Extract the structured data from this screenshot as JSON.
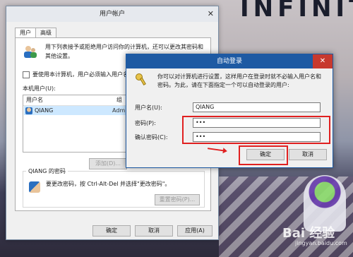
{
  "main_dialog": {
    "title": "用户帐户",
    "tabs": [
      "用户",
      "高级"
    ],
    "intro": "用下列表接予或拒绝用户访问你的计算机，还可以更改其密码和其他设置。",
    "checkbox_label": "要使用本计算机，用户必须输入用户名和密",
    "users_label": "本机用户(U):",
    "columns": [
      "用户名",
      "组"
    ],
    "rows": [
      {
        "name": "QIANG",
        "group": "Admi"
      }
    ],
    "buttons": {
      "add": "添加(D)...",
      "reset_password": "重置密码(P)...",
      "ok": "确定",
      "cancel": "取消",
      "apply": "应用(A)"
    },
    "password_group_title": "QIANG 的密码",
    "password_text": "要更改密码，按 Ctrl-Alt-Del 并选择\"更改密码\"。"
  },
  "auto_login": {
    "title": "自动登录",
    "intro": "你可以对计算机进行设置，这样用户在登录时就不必输入用户名和密码。为此，请在下面指定一个可以自动登录的用户:",
    "username_label": "用户名(U):",
    "username_value": "QIANG",
    "password_label": "密码(P):",
    "password_value": "•••",
    "confirm_label": "确认密码(C):",
    "confirm_value": "•••",
    "ok": "确定",
    "cancel": "取消"
  },
  "background": {
    "logo": "INFINIT"
  },
  "watermark": {
    "text": "Bai 经验",
    "url": "jingyan.baidu.com"
  },
  "colors": {
    "highlight_red": "#e02020",
    "title_blue": "#1e5aa3"
  }
}
